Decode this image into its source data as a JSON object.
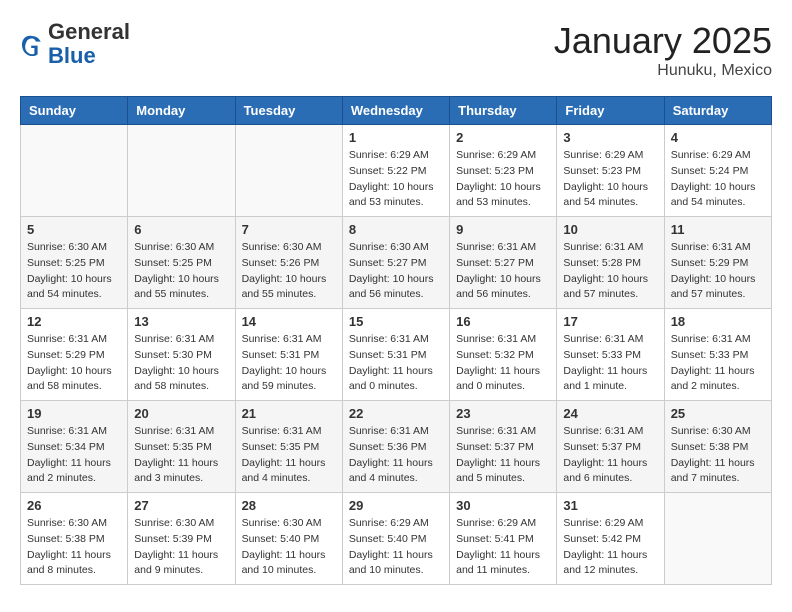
{
  "header": {
    "logo": {
      "general": "General",
      "blue": "Blue"
    },
    "title": "January 2025",
    "location": "Hunuku, Mexico"
  },
  "weekdays": [
    "Sunday",
    "Monday",
    "Tuesday",
    "Wednesday",
    "Thursday",
    "Friday",
    "Saturday"
  ],
  "weeks": [
    [
      {
        "day": "",
        "sunrise": "",
        "sunset": "",
        "daylight": ""
      },
      {
        "day": "",
        "sunrise": "",
        "sunset": "",
        "daylight": ""
      },
      {
        "day": "",
        "sunrise": "",
        "sunset": "",
        "daylight": ""
      },
      {
        "day": "1",
        "sunrise": "Sunrise: 6:29 AM",
        "sunset": "Sunset: 5:22 PM",
        "daylight": "Daylight: 10 hours and 53 minutes."
      },
      {
        "day": "2",
        "sunrise": "Sunrise: 6:29 AM",
        "sunset": "Sunset: 5:23 PM",
        "daylight": "Daylight: 10 hours and 53 minutes."
      },
      {
        "day": "3",
        "sunrise": "Sunrise: 6:29 AM",
        "sunset": "Sunset: 5:23 PM",
        "daylight": "Daylight: 10 hours and 54 minutes."
      },
      {
        "day": "4",
        "sunrise": "Sunrise: 6:29 AM",
        "sunset": "Sunset: 5:24 PM",
        "daylight": "Daylight: 10 hours and 54 minutes."
      }
    ],
    [
      {
        "day": "5",
        "sunrise": "Sunrise: 6:30 AM",
        "sunset": "Sunset: 5:25 PM",
        "daylight": "Daylight: 10 hours and 54 minutes."
      },
      {
        "day": "6",
        "sunrise": "Sunrise: 6:30 AM",
        "sunset": "Sunset: 5:25 PM",
        "daylight": "Daylight: 10 hours and 55 minutes."
      },
      {
        "day": "7",
        "sunrise": "Sunrise: 6:30 AM",
        "sunset": "Sunset: 5:26 PM",
        "daylight": "Daylight: 10 hours and 55 minutes."
      },
      {
        "day": "8",
        "sunrise": "Sunrise: 6:30 AM",
        "sunset": "Sunset: 5:27 PM",
        "daylight": "Daylight: 10 hours and 56 minutes."
      },
      {
        "day": "9",
        "sunrise": "Sunrise: 6:31 AM",
        "sunset": "Sunset: 5:27 PM",
        "daylight": "Daylight: 10 hours and 56 minutes."
      },
      {
        "day": "10",
        "sunrise": "Sunrise: 6:31 AM",
        "sunset": "Sunset: 5:28 PM",
        "daylight": "Daylight: 10 hours and 57 minutes."
      },
      {
        "day": "11",
        "sunrise": "Sunrise: 6:31 AM",
        "sunset": "Sunset: 5:29 PM",
        "daylight": "Daylight: 10 hours and 57 minutes."
      }
    ],
    [
      {
        "day": "12",
        "sunrise": "Sunrise: 6:31 AM",
        "sunset": "Sunset: 5:29 PM",
        "daylight": "Daylight: 10 hours and 58 minutes."
      },
      {
        "day": "13",
        "sunrise": "Sunrise: 6:31 AM",
        "sunset": "Sunset: 5:30 PM",
        "daylight": "Daylight: 10 hours and 58 minutes."
      },
      {
        "day": "14",
        "sunrise": "Sunrise: 6:31 AM",
        "sunset": "Sunset: 5:31 PM",
        "daylight": "Daylight: 10 hours and 59 minutes."
      },
      {
        "day": "15",
        "sunrise": "Sunrise: 6:31 AM",
        "sunset": "Sunset: 5:31 PM",
        "daylight": "Daylight: 11 hours and 0 minutes."
      },
      {
        "day": "16",
        "sunrise": "Sunrise: 6:31 AM",
        "sunset": "Sunset: 5:32 PM",
        "daylight": "Daylight: 11 hours and 0 minutes."
      },
      {
        "day": "17",
        "sunrise": "Sunrise: 6:31 AM",
        "sunset": "Sunset: 5:33 PM",
        "daylight": "Daylight: 11 hours and 1 minute."
      },
      {
        "day": "18",
        "sunrise": "Sunrise: 6:31 AM",
        "sunset": "Sunset: 5:33 PM",
        "daylight": "Daylight: 11 hours and 2 minutes."
      }
    ],
    [
      {
        "day": "19",
        "sunrise": "Sunrise: 6:31 AM",
        "sunset": "Sunset: 5:34 PM",
        "daylight": "Daylight: 11 hours and 2 minutes."
      },
      {
        "day": "20",
        "sunrise": "Sunrise: 6:31 AM",
        "sunset": "Sunset: 5:35 PM",
        "daylight": "Daylight: 11 hours and 3 minutes."
      },
      {
        "day": "21",
        "sunrise": "Sunrise: 6:31 AM",
        "sunset": "Sunset: 5:35 PM",
        "daylight": "Daylight: 11 hours and 4 minutes."
      },
      {
        "day": "22",
        "sunrise": "Sunrise: 6:31 AM",
        "sunset": "Sunset: 5:36 PM",
        "daylight": "Daylight: 11 hours and 4 minutes."
      },
      {
        "day": "23",
        "sunrise": "Sunrise: 6:31 AM",
        "sunset": "Sunset: 5:37 PM",
        "daylight": "Daylight: 11 hours and 5 minutes."
      },
      {
        "day": "24",
        "sunrise": "Sunrise: 6:31 AM",
        "sunset": "Sunset: 5:37 PM",
        "daylight": "Daylight: 11 hours and 6 minutes."
      },
      {
        "day": "25",
        "sunrise": "Sunrise: 6:30 AM",
        "sunset": "Sunset: 5:38 PM",
        "daylight": "Daylight: 11 hours and 7 minutes."
      }
    ],
    [
      {
        "day": "26",
        "sunrise": "Sunrise: 6:30 AM",
        "sunset": "Sunset: 5:38 PM",
        "daylight": "Daylight: 11 hours and 8 minutes."
      },
      {
        "day": "27",
        "sunrise": "Sunrise: 6:30 AM",
        "sunset": "Sunset: 5:39 PM",
        "daylight": "Daylight: 11 hours and 9 minutes."
      },
      {
        "day": "28",
        "sunrise": "Sunrise: 6:30 AM",
        "sunset": "Sunset: 5:40 PM",
        "daylight": "Daylight: 11 hours and 10 minutes."
      },
      {
        "day": "29",
        "sunrise": "Sunrise: 6:29 AM",
        "sunset": "Sunset: 5:40 PM",
        "daylight": "Daylight: 11 hours and 10 minutes."
      },
      {
        "day": "30",
        "sunrise": "Sunrise: 6:29 AM",
        "sunset": "Sunset: 5:41 PM",
        "daylight": "Daylight: 11 hours and 11 minutes."
      },
      {
        "day": "31",
        "sunrise": "Sunrise: 6:29 AM",
        "sunset": "Sunset: 5:42 PM",
        "daylight": "Daylight: 11 hours and 12 minutes."
      },
      {
        "day": "",
        "sunrise": "",
        "sunset": "",
        "daylight": ""
      }
    ]
  ]
}
